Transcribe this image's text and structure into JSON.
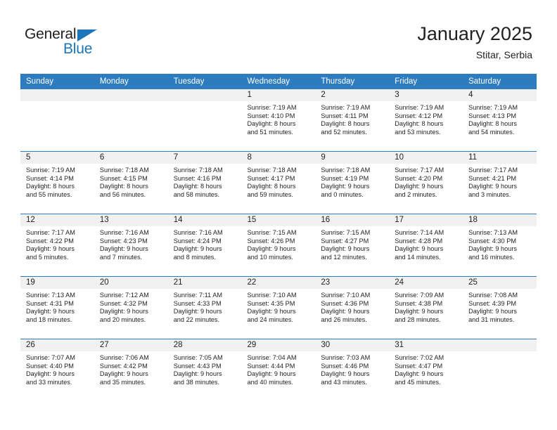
{
  "brand": {
    "name_top": "General",
    "name_bottom": "Blue",
    "accent_color": "#1b75bb",
    "triangle_icon": "triangle-icon"
  },
  "header": {
    "title": "January 2025",
    "subtitle": "Stitar, Serbia"
  },
  "calendar": {
    "header_bg": "#2e7cc0",
    "daynum_bg": "#f1f1f1",
    "weekday_headers": [
      "Sunday",
      "Monday",
      "Tuesday",
      "Wednesday",
      "Thursday",
      "Friday",
      "Saturday"
    ],
    "weeks": [
      [
        {
          "day": "",
          "lines": []
        },
        {
          "day": "",
          "lines": []
        },
        {
          "day": "",
          "lines": []
        },
        {
          "day": "1",
          "lines": [
            "Sunrise: 7:19 AM",
            "Sunset: 4:10 PM",
            "Daylight: 8 hours",
            "and 51 minutes."
          ]
        },
        {
          "day": "2",
          "lines": [
            "Sunrise: 7:19 AM",
            "Sunset: 4:11 PM",
            "Daylight: 8 hours",
            "and 52 minutes."
          ]
        },
        {
          "day": "3",
          "lines": [
            "Sunrise: 7:19 AM",
            "Sunset: 4:12 PM",
            "Daylight: 8 hours",
            "and 53 minutes."
          ]
        },
        {
          "day": "4",
          "lines": [
            "Sunrise: 7:19 AM",
            "Sunset: 4:13 PM",
            "Daylight: 8 hours",
            "and 54 minutes."
          ]
        }
      ],
      [
        {
          "day": "5",
          "lines": [
            "Sunrise: 7:19 AM",
            "Sunset: 4:14 PM",
            "Daylight: 8 hours",
            "and 55 minutes."
          ]
        },
        {
          "day": "6",
          "lines": [
            "Sunrise: 7:18 AM",
            "Sunset: 4:15 PM",
            "Daylight: 8 hours",
            "and 56 minutes."
          ]
        },
        {
          "day": "7",
          "lines": [
            "Sunrise: 7:18 AM",
            "Sunset: 4:16 PM",
            "Daylight: 8 hours",
            "and 58 minutes."
          ]
        },
        {
          "day": "8",
          "lines": [
            "Sunrise: 7:18 AM",
            "Sunset: 4:17 PM",
            "Daylight: 8 hours",
            "and 59 minutes."
          ]
        },
        {
          "day": "9",
          "lines": [
            "Sunrise: 7:18 AM",
            "Sunset: 4:19 PM",
            "Daylight: 9 hours",
            "and 0 minutes."
          ]
        },
        {
          "day": "10",
          "lines": [
            "Sunrise: 7:17 AM",
            "Sunset: 4:20 PM",
            "Daylight: 9 hours",
            "and 2 minutes."
          ]
        },
        {
          "day": "11",
          "lines": [
            "Sunrise: 7:17 AM",
            "Sunset: 4:21 PM",
            "Daylight: 9 hours",
            "and 3 minutes."
          ]
        }
      ],
      [
        {
          "day": "12",
          "lines": [
            "Sunrise: 7:17 AM",
            "Sunset: 4:22 PM",
            "Daylight: 9 hours",
            "and 5 minutes."
          ]
        },
        {
          "day": "13",
          "lines": [
            "Sunrise: 7:16 AM",
            "Sunset: 4:23 PM",
            "Daylight: 9 hours",
            "and 7 minutes."
          ]
        },
        {
          "day": "14",
          "lines": [
            "Sunrise: 7:16 AM",
            "Sunset: 4:24 PM",
            "Daylight: 9 hours",
            "and 8 minutes."
          ]
        },
        {
          "day": "15",
          "lines": [
            "Sunrise: 7:15 AM",
            "Sunset: 4:26 PM",
            "Daylight: 9 hours",
            "and 10 minutes."
          ]
        },
        {
          "day": "16",
          "lines": [
            "Sunrise: 7:15 AM",
            "Sunset: 4:27 PM",
            "Daylight: 9 hours",
            "and 12 minutes."
          ]
        },
        {
          "day": "17",
          "lines": [
            "Sunrise: 7:14 AM",
            "Sunset: 4:28 PM",
            "Daylight: 9 hours",
            "and 14 minutes."
          ]
        },
        {
          "day": "18",
          "lines": [
            "Sunrise: 7:13 AM",
            "Sunset: 4:30 PM",
            "Daylight: 9 hours",
            "and 16 minutes."
          ]
        }
      ],
      [
        {
          "day": "19",
          "lines": [
            "Sunrise: 7:13 AM",
            "Sunset: 4:31 PM",
            "Daylight: 9 hours",
            "and 18 minutes."
          ]
        },
        {
          "day": "20",
          "lines": [
            "Sunrise: 7:12 AM",
            "Sunset: 4:32 PM",
            "Daylight: 9 hours",
            "and 20 minutes."
          ]
        },
        {
          "day": "21",
          "lines": [
            "Sunrise: 7:11 AM",
            "Sunset: 4:33 PM",
            "Daylight: 9 hours",
            "and 22 minutes."
          ]
        },
        {
          "day": "22",
          "lines": [
            "Sunrise: 7:10 AM",
            "Sunset: 4:35 PM",
            "Daylight: 9 hours",
            "and 24 minutes."
          ]
        },
        {
          "day": "23",
          "lines": [
            "Sunrise: 7:10 AM",
            "Sunset: 4:36 PM",
            "Daylight: 9 hours",
            "and 26 minutes."
          ]
        },
        {
          "day": "24",
          "lines": [
            "Sunrise: 7:09 AM",
            "Sunset: 4:38 PM",
            "Daylight: 9 hours",
            "and 28 minutes."
          ]
        },
        {
          "day": "25",
          "lines": [
            "Sunrise: 7:08 AM",
            "Sunset: 4:39 PM",
            "Daylight: 9 hours",
            "and 31 minutes."
          ]
        }
      ],
      [
        {
          "day": "26",
          "lines": [
            "Sunrise: 7:07 AM",
            "Sunset: 4:40 PM",
            "Daylight: 9 hours",
            "and 33 minutes."
          ]
        },
        {
          "day": "27",
          "lines": [
            "Sunrise: 7:06 AM",
            "Sunset: 4:42 PM",
            "Daylight: 9 hours",
            "and 35 minutes."
          ]
        },
        {
          "day": "28",
          "lines": [
            "Sunrise: 7:05 AM",
            "Sunset: 4:43 PM",
            "Daylight: 9 hours",
            "and 38 minutes."
          ]
        },
        {
          "day": "29",
          "lines": [
            "Sunrise: 7:04 AM",
            "Sunset: 4:44 PM",
            "Daylight: 9 hours",
            "and 40 minutes."
          ]
        },
        {
          "day": "30",
          "lines": [
            "Sunrise: 7:03 AM",
            "Sunset: 4:46 PM",
            "Daylight: 9 hours",
            "and 43 minutes."
          ]
        },
        {
          "day": "31",
          "lines": [
            "Sunrise: 7:02 AM",
            "Sunset: 4:47 PM",
            "Daylight: 9 hours",
            "and 45 minutes."
          ]
        },
        {
          "day": "",
          "lines": []
        }
      ]
    ]
  }
}
